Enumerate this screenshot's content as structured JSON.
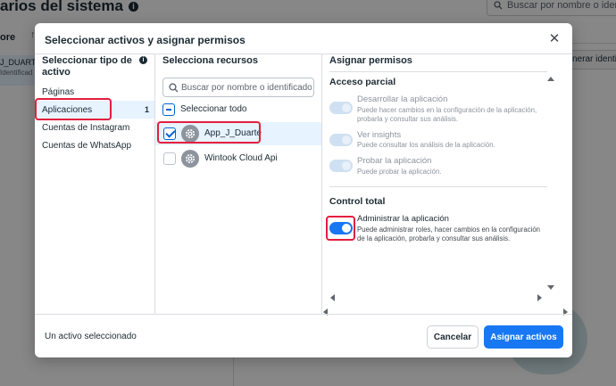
{
  "background": {
    "page_title": "arios del sistema",
    "search_placeholder": "Buscar por nombre o identifi",
    "sort_label": "ore",
    "sort_arrow": "↑",
    "row_name": "J_DUARTE",
    "row_sub": "Identificad",
    "button_label": "nerar identi"
  },
  "modal": {
    "title": "Seleccionar activos y asignar permisos",
    "close_label": "✕",
    "asset_types": {
      "title": "Seleccionar tipo de activo",
      "info": "i",
      "items": [
        {
          "label": "Páginas",
          "count": ""
        },
        {
          "label": "Aplicaciones",
          "count": "1"
        },
        {
          "label": "Cuentas de Instagram",
          "count": ""
        },
        {
          "label": "Cuentas de WhatsApp",
          "count": ""
        }
      ],
      "selected_index": 1
    },
    "resources": {
      "title": "Selecciona recursos",
      "search_placeholder": "Buscar por nombre o identificador",
      "select_all_label": "Seleccionar todo",
      "items": [
        {
          "name": "App_J_Duarte",
          "checked": true
        },
        {
          "name": "Wintook Cloud Api",
          "checked": false
        }
      ]
    },
    "permissions": {
      "title": "Asignar permisos",
      "partial": {
        "heading": "Acceso parcial",
        "items": [
          {
            "title": "Desarrollar la aplicación",
            "description": "Puede hacer cambios en la configuración de la aplicación, probarla y consultar sus análisis.",
            "enabled": false
          },
          {
            "title": "Ver insights",
            "description": "Puede consultar los análisis de la aplicación.",
            "enabled": false
          },
          {
            "title": "Probar la aplicación",
            "description": "Puede probar la aplicación.",
            "enabled": false
          }
        ]
      },
      "full": {
        "heading": "Control total",
        "items": [
          {
            "title": "Administrar la aplicación",
            "description": "Puede administrar roles, hacer cambios en la configuración de la aplicación, probarla y consultar sus análisis.",
            "enabled": true
          }
        ]
      }
    },
    "footer": {
      "status": "Un activo seleccionado",
      "cancel_label": "Cancelar",
      "submit_label": "Asignar activos"
    }
  },
  "colors": {
    "accent": "#1877f2",
    "highlight": "#e41e3f",
    "selected_bg": "#e7f3ff"
  }
}
